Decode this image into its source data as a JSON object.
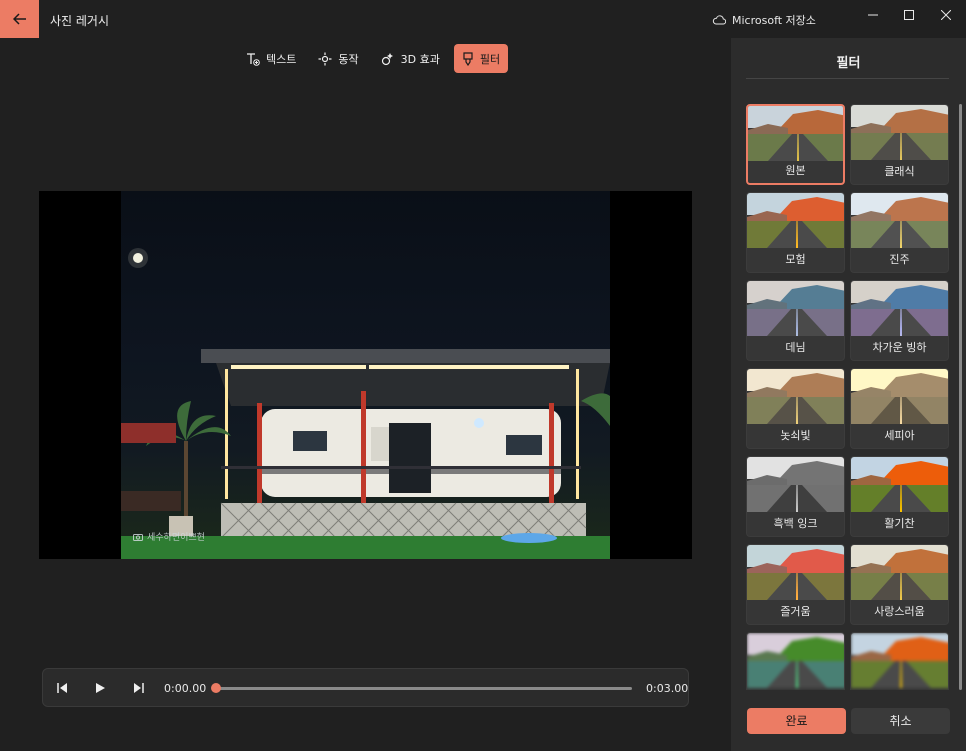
{
  "app": {
    "title": "사진 레거시",
    "store_link": "Microsoft 저장소"
  },
  "toolbar": {
    "items": [
      {
        "label": "텍스트",
        "icon": "text-icon"
      },
      {
        "label": "동작",
        "icon": "motion-icon"
      },
      {
        "label": "3D 효과",
        "icon": "3d-effects-icon"
      },
      {
        "label": "필터",
        "icon": "filter-icon",
        "active": true
      }
    ]
  },
  "preview": {
    "watermark": "세수하면이쁘현"
  },
  "player": {
    "current_time": "0:00.00",
    "total_time": "0:03.00",
    "progress": 0
  },
  "filters": {
    "title": "필터",
    "items": [
      {
        "label": "원본",
        "selected": true
      },
      {
        "label": "클래식"
      },
      {
        "label": "모험"
      },
      {
        "label": "진주"
      },
      {
        "label": "데님"
      },
      {
        "label": "차가운 빙하"
      },
      {
        "label": "놋쇠빛"
      },
      {
        "label": "세피아"
      },
      {
        "label": "흑백 잉크"
      },
      {
        "label": "활기찬"
      },
      {
        "label": "즐거움"
      },
      {
        "label": "사랑스러움"
      },
      {
        "label": ""
      },
      {
        "label": ""
      }
    ]
  },
  "actions": {
    "done": "완료",
    "cancel": "취소"
  },
  "colors": {
    "accent": "#ec7c64",
    "background": "#202020",
    "panel": "#2c2c2c"
  }
}
